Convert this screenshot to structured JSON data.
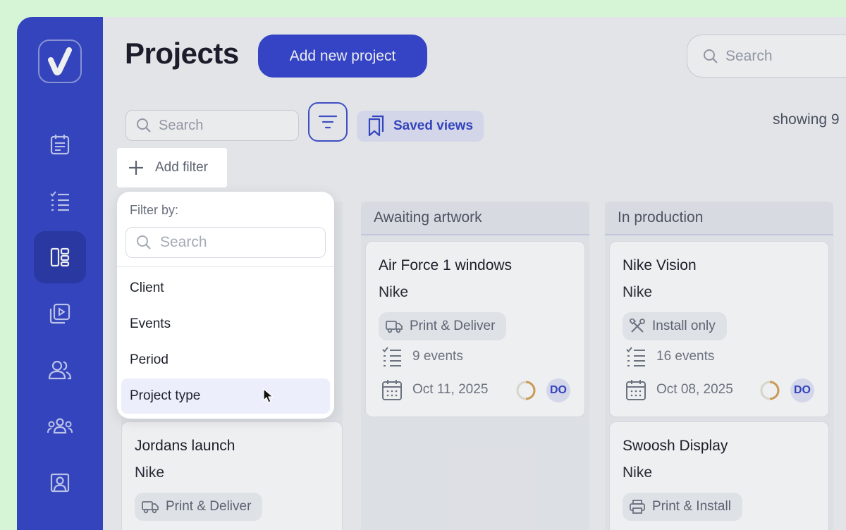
{
  "page": {
    "title": "Projects"
  },
  "toolbar": {
    "add_project_label": "Add new project",
    "top_search_placeholder": "Search",
    "filter_search_placeholder": "Search",
    "saved_views_label": "Saved views",
    "showing_text": "showing 9"
  },
  "sidebar": {
    "items": [
      {
        "icon": "calendar-icon"
      },
      {
        "icon": "checklist-icon"
      },
      {
        "icon": "board-icon",
        "active": true
      },
      {
        "icon": "video-library-icon"
      },
      {
        "icon": "users-icon"
      },
      {
        "icon": "team-icon"
      },
      {
        "icon": "contact-card-icon"
      }
    ]
  },
  "columns": [
    {
      "header": "",
      "cards": [
        {
          "title": "Jordans launch",
          "client": "Nike",
          "type": "Print & Deliver",
          "type_icon": "truck-icon"
        }
      ]
    },
    {
      "header": "Awaiting artwork",
      "cards": [
        {
          "title": "Air Force 1 windows",
          "client": "Nike",
          "type": "Print & Deliver",
          "type_icon": "truck-icon",
          "events": "9 events",
          "date": "Oct 11, 2025",
          "avatar": "DO"
        }
      ]
    },
    {
      "header": "In production",
      "cards": [
        {
          "title": "Nike Vision",
          "client": "Nike",
          "type": "Install only",
          "type_icon": "tools-icon",
          "events": "16 events",
          "date": "Oct 08, 2025",
          "avatar": "DO"
        },
        {
          "title": "Swoosh Display",
          "client": "Nike",
          "type": "Print & Install",
          "type_icon": "printer-icon"
        }
      ]
    }
  ],
  "filter_menu": {
    "add_filter_label": "Add filter",
    "label": "Filter by:",
    "search_placeholder": "Search",
    "options": [
      "Client",
      "Events",
      "Period",
      "Project type"
    ],
    "hovered_option": "Project type"
  },
  "colors": {
    "accent": "#3747c7",
    "background": "#d5f5d6",
    "progress": "#d9a55a"
  }
}
